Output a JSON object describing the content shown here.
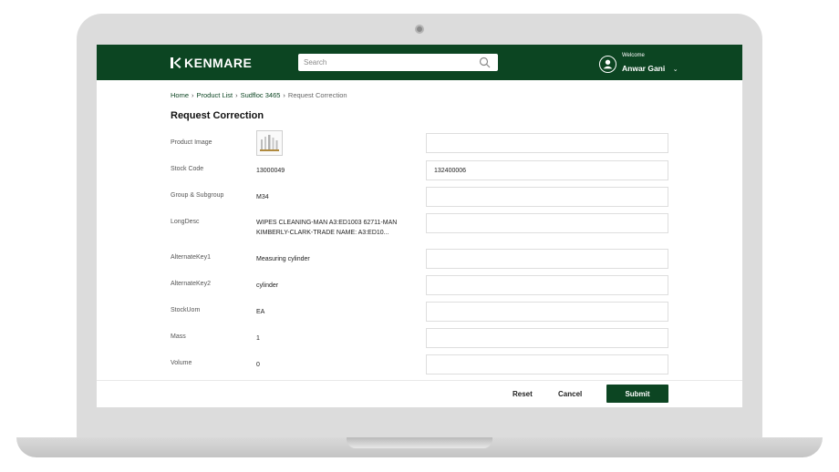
{
  "brand": {
    "name": "KENMARE"
  },
  "header": {
    "search_placeholder": "Search",
    "welcome": "Welcome",
    "user_name": "Anwar Gani"
  },
  "breadcrumb": [
    "Home",
    "Product List",
    "Sudfloc 3465",
    "Request Correction"
  ],
  "page": {
    "title": "Request Correction"
  },
  "form": {
    "rows": [
      {
        "label": "Product Image",
        "value": "",
        "correction": ""
      },
      {
        "label": "Stock Code",
        "value": "13000049",
        "correction": "132400006"
      },
      {
        "label": "Group & Subgroup",
        "value": "M34",
        "correction": ""
      },
      {
        "label": "LongDesc",
        "value": "WIPES CLEANING-MAN A3:ED1003 62711-MAN KIMBERLY-CLARK-TRADE NAME: A3:ED10...",
        "correction": ""
      },
      {
        "label": "AlternateKey1",
        "value": "Measuring cylinder",
        "correction": ""
      },
      {
        "label": "AlternateKey2",
        "value": "cylinder",
        "correction": ""
      },
      {
        "label": "StockUom",
        "value": "EA",
        "correction": ""
      },
      {
        "label": "Mass",
        "value": "1",
        "correction": ""
      },
      {
        "label": "Volume",
        "value": "0",
        "correction": ""
      }
    ]
  },
  "actions": {
    "reset": "Reset",
    "cancel": "Cancel",
    "submit": "Submit"
  },
  "colors": {
    "brand_green": "#0c4522",
    "laptop_frame": "#dcdcdc"
  }
}
